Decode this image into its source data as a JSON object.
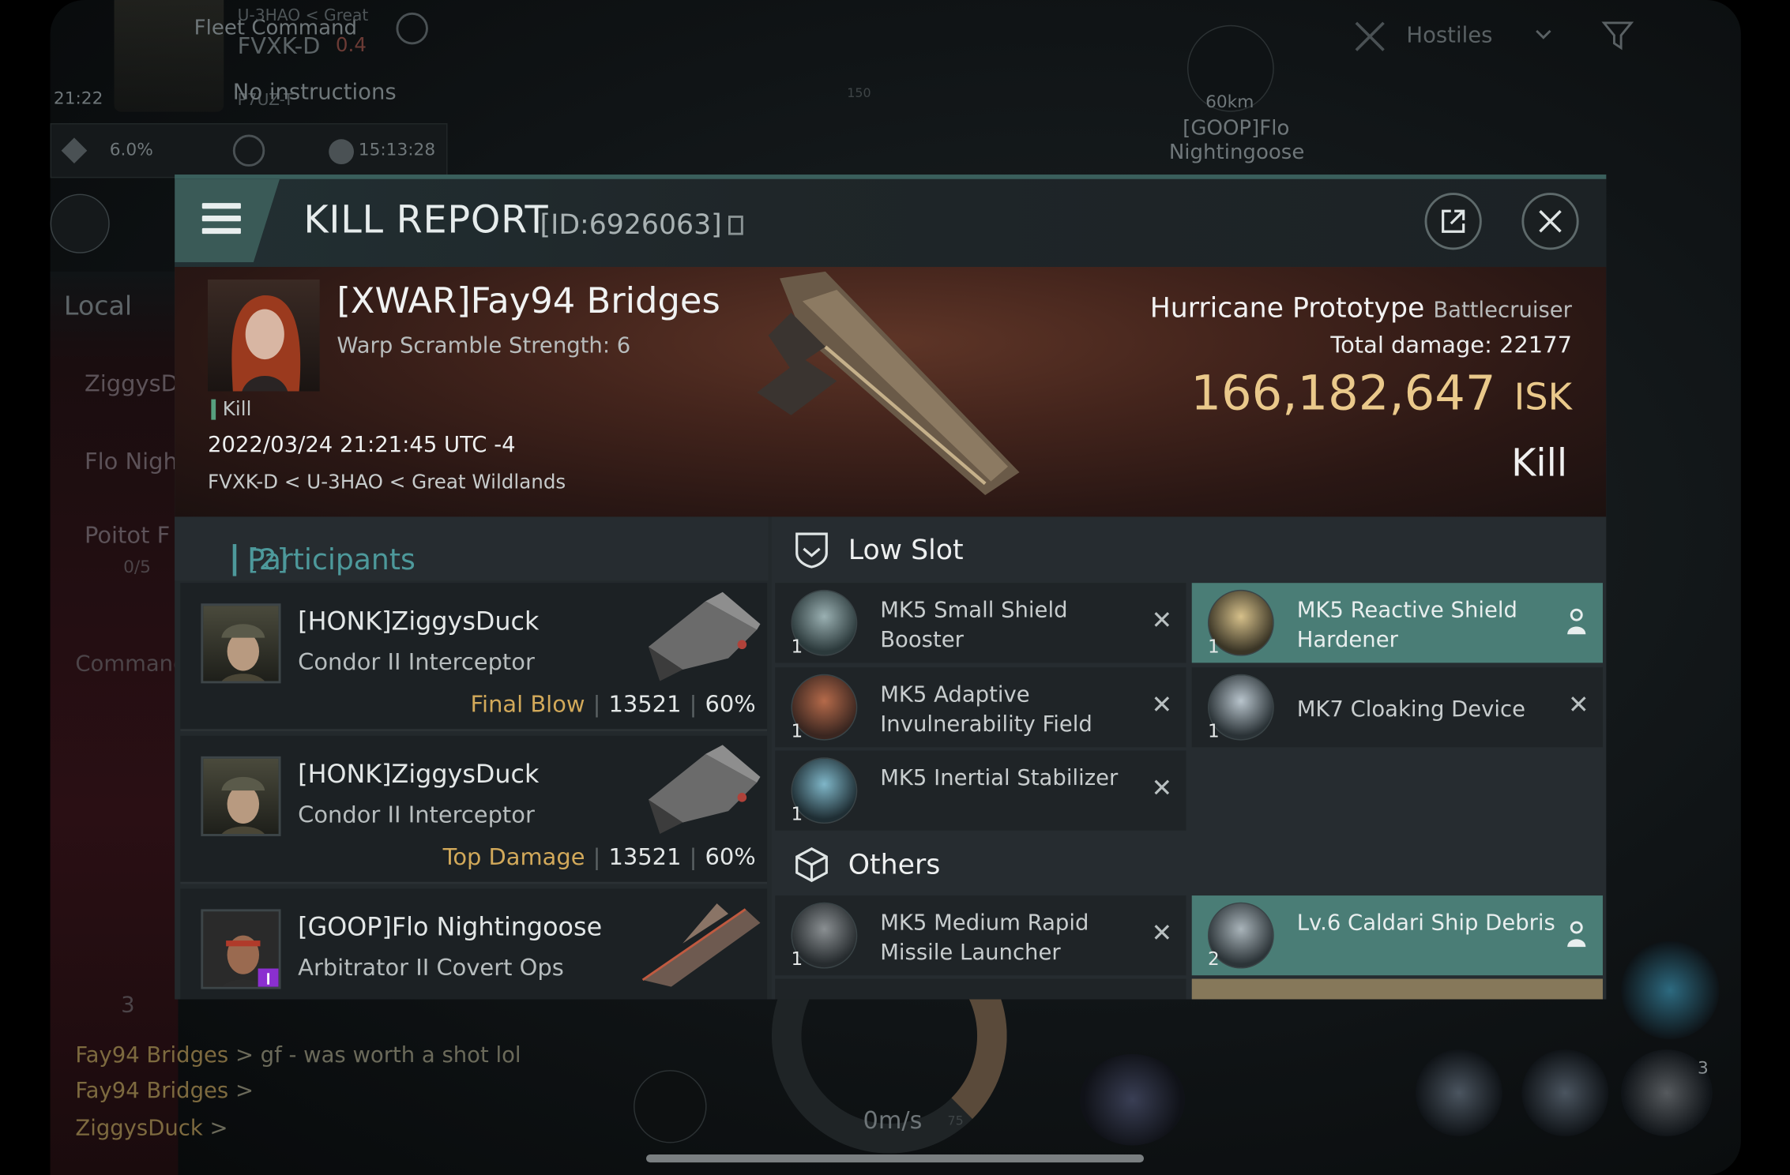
{
  "hud": {
    "fleet_label": "Fleet Command",
    "system": "FVXK-D",
    "system_sec": "0.4",
    "region_hint": "U-3HAO < Great",
    "nearby_system": "P7UZ-T",
    "instructions": "No instructions",
    "time": "21:22",
    "cargo_pct": "6.0%",
    "server_time": "15:13:28",
    "local_tab": "Local",
    "local_list": [
      "ZiggysD",
      "Flo Nigh",
      "Poitot F",
      "0/5",
      "Command"
    ],
    "overview_filter": "Hostiles",
    "target_distance": "60km",
    "target_name": "[GOOP]Flo",
    "target_name2": "Nightingoose",
    "range_tick": "150",
    "speed": "0m/s",
    "speed_tick": "75",
    "module_count": "3",
    "member_count": "3",
    "chat": [
      {
        "name": "Fay94 Bridges",
        "text": " > gf - was worth a shot lol"
      },
      {
        "name": "Fay94 Bridges",
        "text": " > "
      },
      {
        "name": "ZiggysDuck",
        "text": " > "
      }
    ]
  },
  "modal": {
    "title": "KILL REPORT",
    "report_id": "[ID:6926063]",
    "victim": {
      "name": "[XWAR]Fay94 Bridges",
      "warp_scramble": "Warp Scramble Strength: 6",
      "tag": "Kill",
      "datetime": "2022/03/24 21:21:45 UTC -4",
      "location": "FVXK-D < U-3HAO < Great Wildlands"
    },
    "ship": {
      "name": "Hurricane Prototype",
      "class": "Battlecruiser",
      "total_damage_label": "Total damage:",
      "total_damage": "22177",
      "isk_value": "166,182,647",
      "isk_unit": "ISK",
      "result": "Kill"
    },
    "participants_label": "Participants",
    "participants_count": "[2]",
    "participants": [
      {
        "name": "[HONK]ZiggysDuck",
        "ship": "Condor II Interceptor",
        "label": "Final Blow",
        "damage": "13521",
        "pct": "60%"
      },
      {
        "name": "[HONK]ZiggysDuck",
        "ship": "Condor II Interceptor",
        "label": "Top Damage",
        "damage": "13521",
        "pct": "60%"
      },
      {
        "name": "[GOOP]Flo Nightingoose",
        "ship": "Arbitrator II Covert Ops",
        "label": "",
        "damage": "",
        "pct": ""
      }
    ],
    "low_slot_label": "Low Slot",
    "low_slot": [
      {
        "name": "MK5 Small Shield Booster",
        "qty": "1",
        "state": "destroyed"
      },
      {
        "name": "MK5 Reactive Shield Hardener",
        "qty": "1",
        "state": "dropped"
      },
      {
        "name": "MK5 Adaptive Invulnerability Field",
        "qty": "1",
        "state": "destroyed"
      },
      {
        "name": "MK7 Cloaking Device",
        "qty": "1",
        "state": "destroyed"
      },
      {
        "name": "MK5 Inertial Stabilizer",
        "qty": "1",
        "state": "destroyed"
      }
    ],
    "others_label": "Others",
    "others": [
      {
        "name": "MK5 Medium Rapid Missile Launcher",
        "qty": "1",
        "state": "destroyed"
      },
      {
        "name": "Lv.6 Caldari Ship Debris",
        "qty": "2",
        "state": "dropped"
      }
    ]
  },
  "colors": {
    "accent_teal": "#4a7d76",
    "isk_gold": "#eac98b",
    "label_gold": "#d2a95a",
    "participants_teal": "#4d999b"
  }
}
